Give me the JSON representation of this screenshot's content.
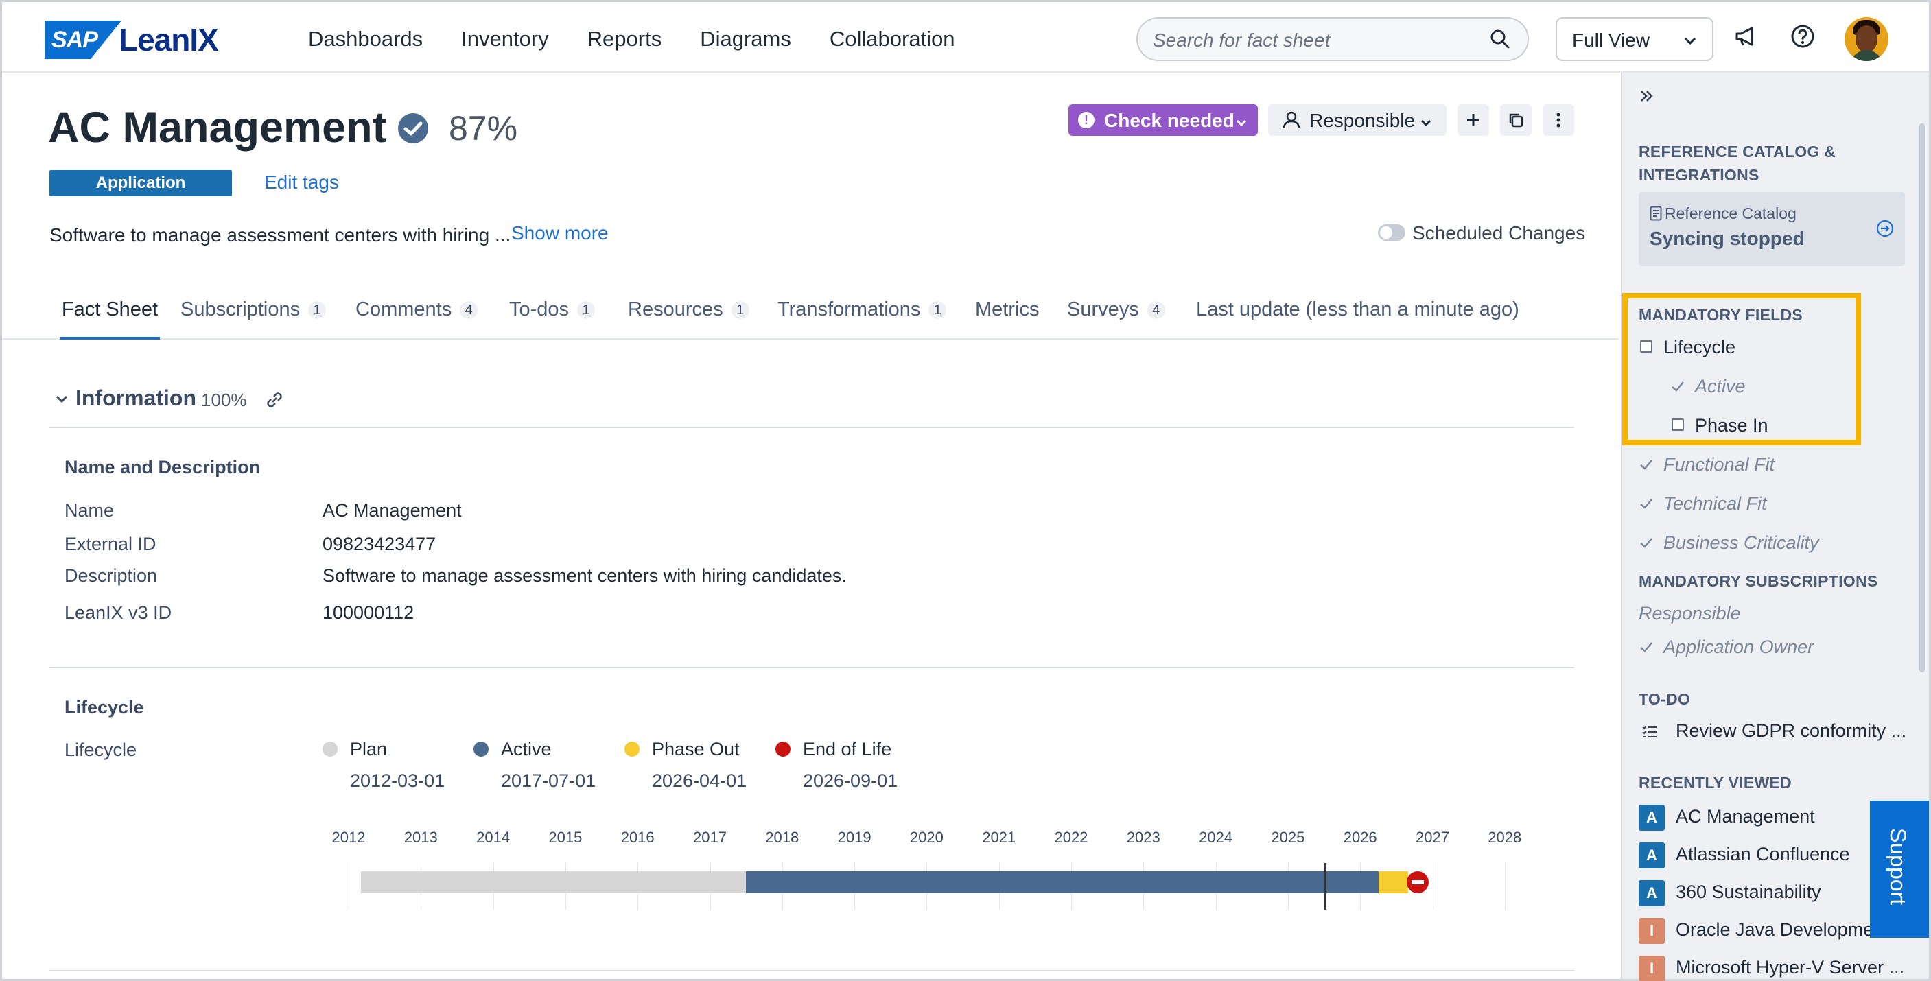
{
  "brand": {
    "sap": "SAP",
    "product": "LeanIX"
  },
  "nav": [
    "Dashboards",
    "Inventory",
    "Reports",
    "Diagrams",
    "Collaboration"
  ],
  "search": {
    "placeholder": "Search for fact sheet"
  },
  "view_selector": {
    "value": "Full View"
  },
  "factsheet": {
    "title": "AC Management",
    "completion": "87%",
    "status_button": "Check needed",
    "responsible_button": "Responsible",
    "type_tag": "Application",
    "edit_tags": "Edit tags",
    "description_short": "Software to manage assessment centers with hiring ...",
    "show_more": "Show more",
    "scheduled_changes": "Scheduled Changes"
  },
  "tabs": [
    {
      "label": "Fact Sheet",
      "count": ""
    },
    {
      "label": "Subscriptions",
      "count": "1"
    },
    {
      "label": "Comments",
      "count": "4"
    },
    {
      "label": "To-dos",
      "count": "1"
    },
    {
      "label": "Resources",
      "count": "1"
    },
    {
      "label": "Transformations",
      "count": "1"
    },
    {
      "label": "Metrics",
      "count": ""
    },
    {
      "label": "Surveys",
      "count": "4"
    },
    {
      "label": "Last update (less than a minute ago)",
      "count": ""
    }
  ],
  "information": {
    "heading": "Information",
    "completion": "100%",
    "group_name_desc": "Name and Description",
    "fields": [
      {
        "label": "Name",
        "value": "AC Management"
      },
      {
        "label": "External ID",
        "value": "09823423477"
      },
      {
        "label": "Description",
        "value": "Software to manage assessment centers with hiring candidates."
      },
      {
        "label": "LeanIX v3 ID",
        "value": "100000112"
      }
    ],
    "group_lifecycle": "Lifecycle",
    "lifecycle_label": "Lifecycle",
    "phases": [
      {
        "name": "Plan",
        "date": "2012-03-01",
        "color": "#d6d6d6"
      },
      {
        "name": "Active",
        "date": "2017-07-01",
        "color": "#4a6a90"
      },
      {
        "name": "Phase Out",
        "date": "2026-04-01",
        "color": "#f7cc2e"
      },
      {
        "name": "End of Life",
        "date": "2026-09-01",
        "color": "#cc1111"
      }
    ],
    "timeline_years": [
      "2012",
      "2013",
      "2014",
      "2015",
      "2016",
      "2017",
      "2018",
      "2019",
      "2020",
      "2021",
      "2022",
      "2023",
      "2024",
      "2025",
      "2026",
      "2027",
      "2028"
    ]
  },
  "sidebar": {
    "ref_heading": "REFERENCE CATALOG & INTEGRATIONS",
    "ref_small": "Reference Catalog",
    "ref_status": "Syncing stopped",
    "mandatory_heading": "MANDATORY FIELDS",
    "mandatory": [
      {
        "label": "Lifecycle",
        "done": false
      },
      {
        "label": "Active",
        "done": true
      },
      {
        "label": "Phase In",
        "done": false
      },
      {
        "label": "Functional Fit",
        "done": true
      },
      {
        "label": "Technical Fit",
        "done": true
      },
      {
        "label": "Business Criticality",
        "done": true
      }
    ],
    "subs_heading": "MANDATORY SUBSCRIPTIONS",
    "subs": [
      {
        "label": "Responsible",
        "done": false
      },
      {
        "label": "Application Owner",
        "done": true
      }
    ],
    "todo_heading": "TO-DO",
    "todo_item": "Review GDPR conformity ...",
    "recent_heading": "RECENTLY VIEWED",
    "recent": [
      {
        "badge": "A",
        "name": "AC Management",
        "color": "#1a6faf"
      },
      {
        "badge": "A",
        "name": "Atlassian Confluence",
        "color": "#1a6faf"
      },
      {
        "badge": "A",
        "name": "360 Sustainability",
        "color": "#1a6faf"
      },
      {
        "badge": "I",
        "name": "Oracle Java Developme",
        "color": "#d9896a"
      },
      {
        "badge": "I",
        "name": "Microsoft Hyper-V Server ...",
        "color": "#d9896a"
      }
    ],
    "support": "Support"
  }
}
